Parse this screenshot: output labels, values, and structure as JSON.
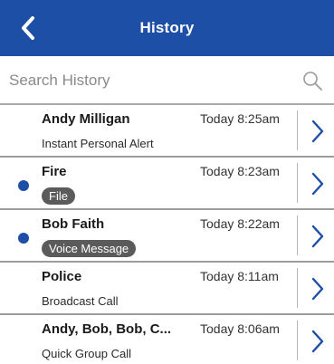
{
  "header": {
    "title": "History",
    "back_icon": "chevron-left-icon",
    "color": "#1e4fa6"
  },
  "search": {
    "placeholder": "Search History",
    "value": "",
    "icon": "search-icon"
  },
  "history": [
    {
      "name": "Andy Milligan",
      "time": "Today 8:25am",
      "subtitle": "Instant Personal Alert",
      "subtitle_style": "text",
      "unread": false
    },
    {
      "name": "Fire",
      "time": "Today 8:23am",
      "subtitle": "File",
      "subtitle_style": "pill",
      "unread": true
    },
    {
      "name": "Bob Faith",
      "time": "Today 8:22am",
      "subtitle": "Voice Message",
      "subtitle_style": "pill",
      "unread": true
    },
    {
      "name": "Police",
      "time": "Today 8:11am",
      "subtitle": "Broadcast Call",
      "subtitle_style": "text",
      "unread": false
    },
    {
      "name": "Andy, Bob, Bob, C...",
      "time": "Today 8:06am",
      "subtitle": "Quick Group Call",
      "subtitle_style": "text",
      "unread": false
    }
  ],
  "colors": {
    "accent": "#1e4fa6",
    "pill": "#5b5b5b",
    "divider": "#9c9c9c"
  }
}
